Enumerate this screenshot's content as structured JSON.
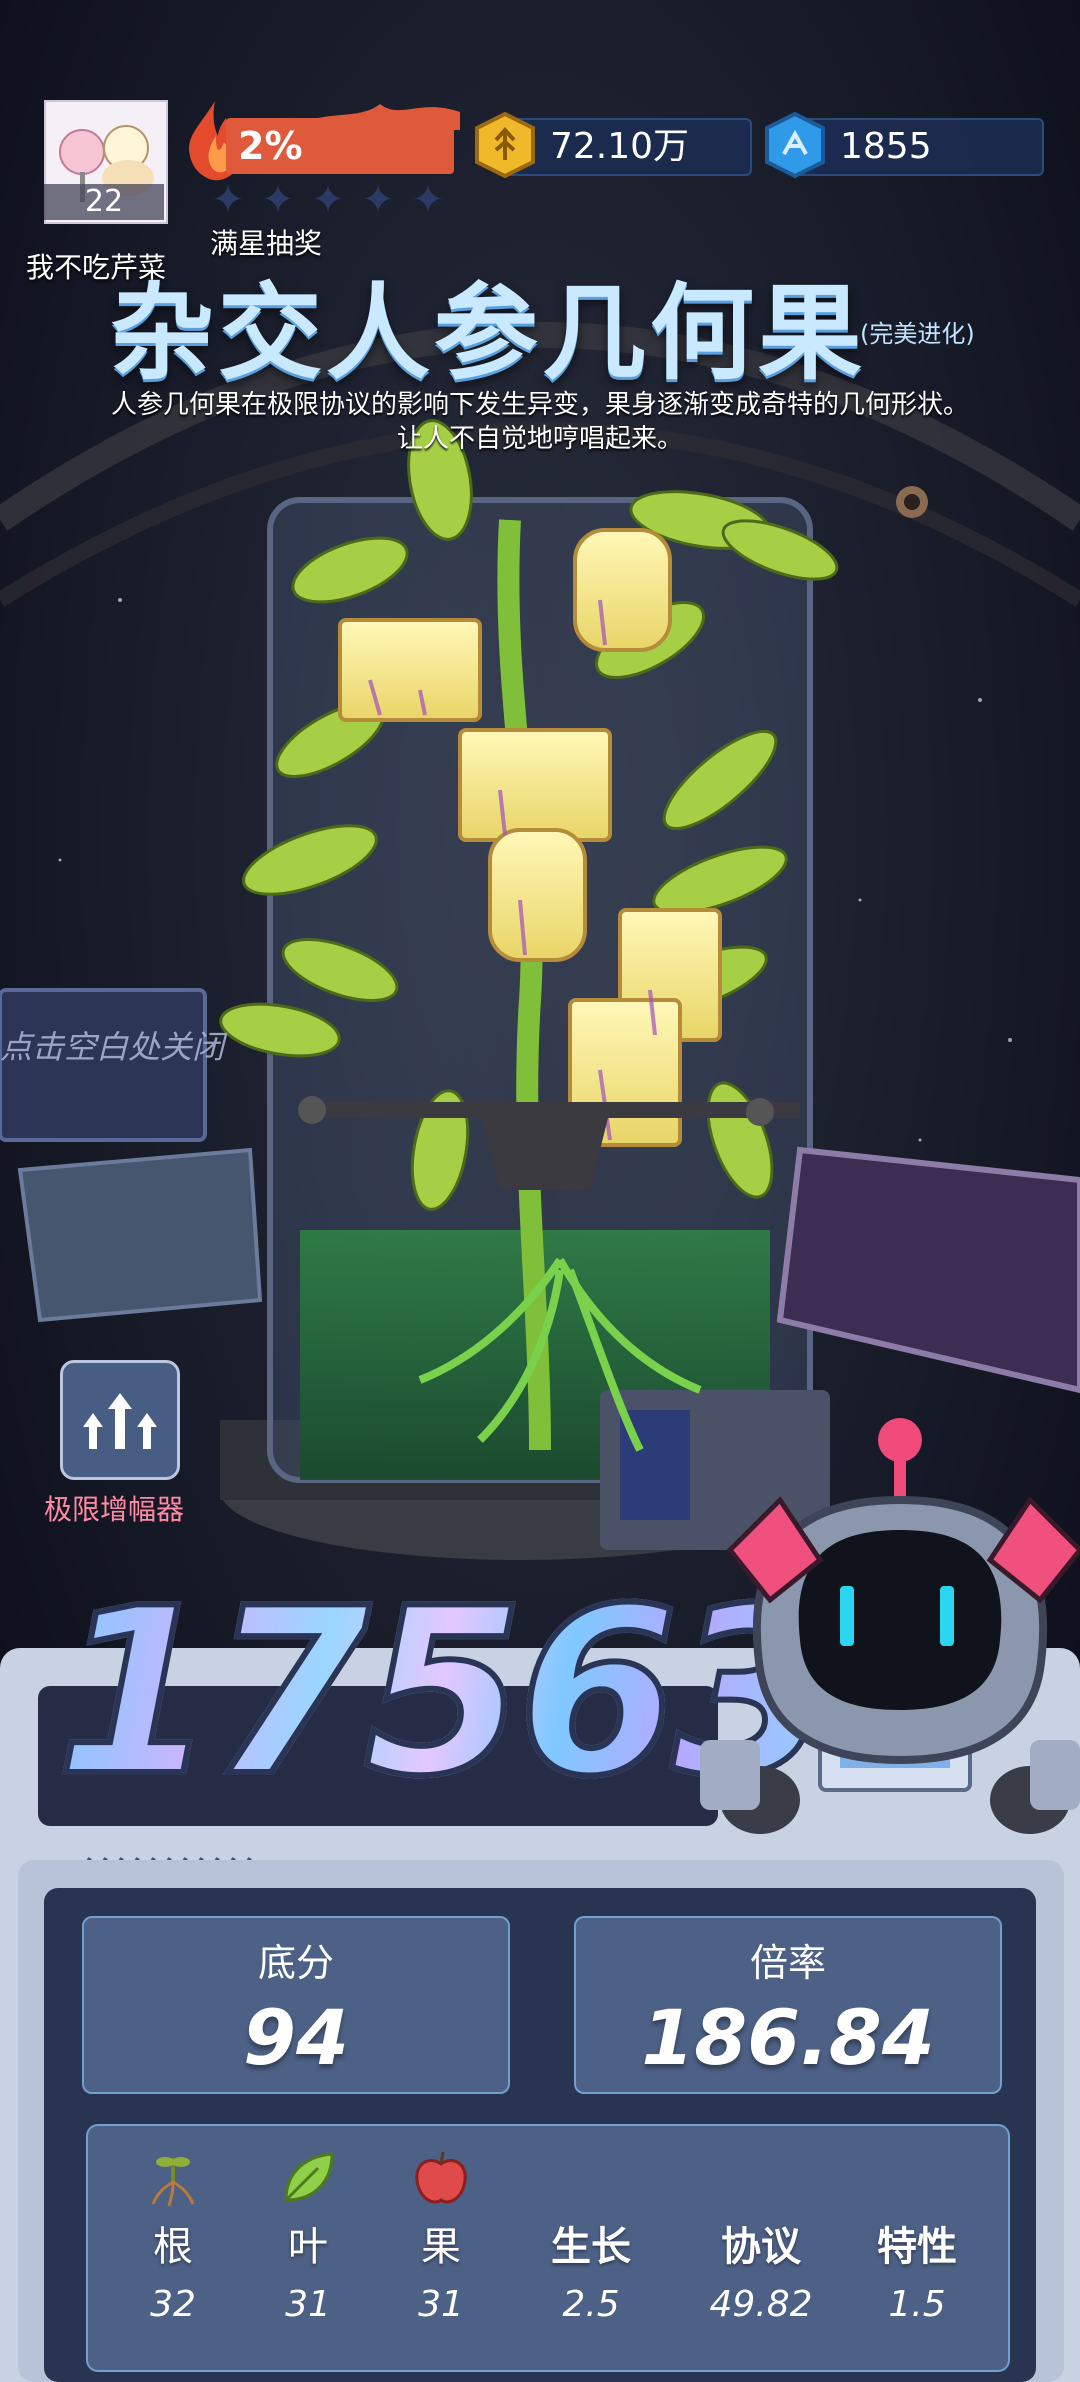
{
  "player": {
    "name": "我不吃芹菜",
    "level": "22"
  },
  "hud": {
    "heat_percent": "2%",
    "lottery_label": "满星抽奖",
    "gold": "72.10万",
    "gems": "1855",
    "stars_filled": 0,
    "stars_total": 5
  },
  "item": {
    "title": "杂交人参几何果",
    "suffix": "(完美进化)",
    "description": "人参几何果在极限协议的影响下发生异变，果身逐渐变成奇特的几何形状。让人不自觉地哼唱起来。"
  },
  "close_hint": "点击空白处关闭",
  "amplifier": {
    "label": "极限增幅器",
    "icon": "triple-up-arrow-icon"
  },
  "score": "17563",
  "stats": {
    "base": {
      "label": "底分",
      "value": "94"
    },
    "multiplier": {
      "label": "倍率",
      "value": "186.84"
    }
  },
  "details": [
    {
      "label": "根",
      "value": "32",
      "icon": "sprout-root-icon"
    },
    {
      "label": "叶",
      "value": "31",
      "icon": "leaf-icon"
    },
    {
      "label": "果",
      "value": "31",
      "icon": "apple-icon"
    },
    {
      "label": "生长",
      "value": "2.5"
    },
    {
      "label": "协议",
      "value": "49.82"
    },
    {
      "label": "特性",
      "value": "1.5"
    }
  ],
  "colors": {
    "heat": "#df5a3b",
    "panel": "#4d6085",
    "accent": "#8fd2ff"
  }
}
